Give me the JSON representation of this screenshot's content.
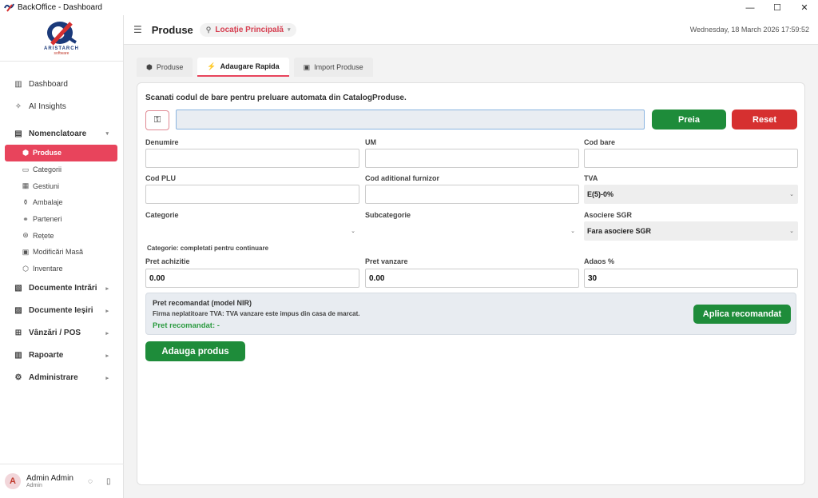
{
  "window": {
    "title": "BackOffice - Dashboard",
    "controls": [
      "—",
      "☐",
      "✕"
    ]
  },
  "brand": {
    "wordmark": "ARISTARCH",
    "sub": "software"
  },
  "sidebar": {
    "items": [
      {
        "label": "Dashboard",
        "icon": "bar-chart-icon"
      },
      {
        "label": "AI Insights",
        "icon": "sparkle-icon"
      }
    ],
    "group_nomenclatoare": {
      "label": "Nomenclatoare",
      "children": [
        {
          "label": "Produse",
          "icon": "box-icon",
          "active": true
        },
        {
          "label": "Categorii",
          "icon": "folder-icon"
        },
        {
          "label": "Gestiuni",
          "icon": "grid-icon"
        },
        {
          "label": "Ambalaje",
          "icon": "bottle-icon"
        },
        {
          "label": "Parteneri",
          "icon": "handshake-icon"
        },
        {
          "label": "Rețete",
          "icon": "recipe-icon"
        },
        {
          "label": "Modificări Masă",
          "icon": "edit-list-icon"
        },
        {
          "label": "Inventare",
          "icon": "inventory-icon"
        }
      ]
    },
    "groups": [
      {
        "label": "Documente Intrări",
        "icon": "document-in-icon"
      },
      {
        "label": "Documente Ieșiri",
        "icon": "document-out-icon"
      },
      {
        "label": "Vânzări / POS",
        "icon": "cart-icon"
      },
      {
        "label": "Rapoarte",
        "icon": "report-icon"
      },
      {
        "label": "Administrare",
        "icon": "gear-icon"
      }
    ]
  },
  "user": {
    "initial": "A",
    "name": "Admin Admin",
    "role": "Admin"
  },
  "header": {
    "title": "Produse",
    "location": "Locație Principală",
    "datetime": "Wednesday, 18 March 2026  17:59:52"
  },
  "tabs": [
    {
      "label": "Produse",
      "icon": "box-icon"
    },
    {
      "label": "Adaugare Rapida",
      "icon": "bolt-icon",
      "active": true
    },
    {
      "label": "Import Produse",
      "icon": "import-icon"
    }
  ],
  "form": {
    "scan_title": "Scanati codul de bare pentru preluare automata din CatalogProduse.",
    "scan_value": "",
    "btn_fetch": "Preia",
    "btn_reset": "Reset",
    "labels": {
      "denumire": "Denumire",
      "um": "UM",
      "cod_bare": "Cod bare",
      "cod_plu": "Cod PLU",
      "cod_furnizor": "Cod aditional furnizor",
      "tva": "TVA",
      "categorie": "Categorie",
      "subcategorie": "Subcategorie",
      "sgr": "Asociere SGR",
      "pret_achizitie": "Pret achizitie",
      "pret_vanzare": "Pret vanzare",
      "adaos": "Adaos %"
    },
    "values": {
      "tva": "E(5)-0%",
      "sgr": "Fara asociere SGR",
      "pret_achizitie": "0.00",
      "pret_vanzare": "0.00",
      "adaos": "30"
    },
    "hint": "Categorie: completati pentru continuare",
    "recommended": {
      "title": "Pret recomandat (model NIR)",
      "note": "Firma neplatitoare TVA: TVA vanzare este impus din casa de marcat.",
      "price": "Pret recomandat: -",
      "apply": "Aplica recomandat"
    },
    "btn_add": "Adauga produs"
  },
  "colors": {
    "accent": "#e8445c",
    "green": "#1e8c3a",
    "red": "#d63030"
  }
}
